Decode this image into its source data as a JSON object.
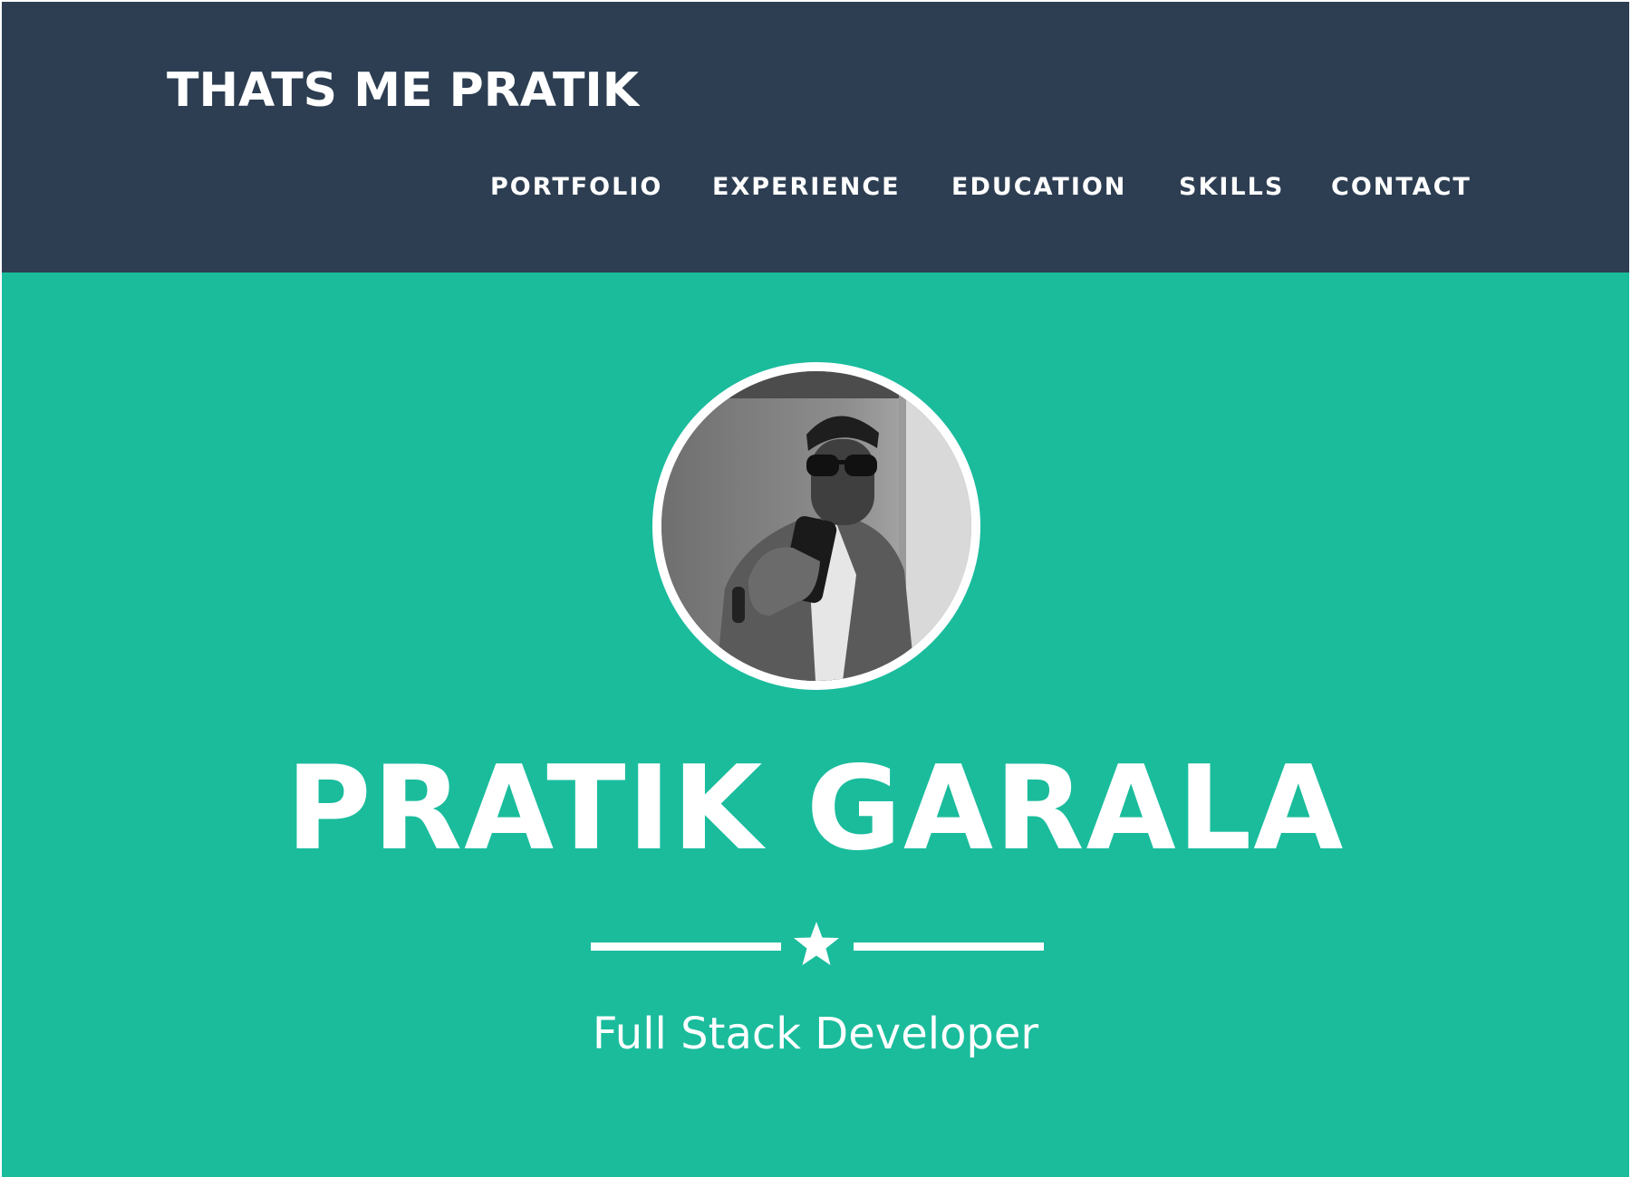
{
  "navbar": {
    "brand": "THATS ME PRATIK",
    "background": "#2d3e52",
    "links": [
      {
        "label": "PORTFOLIO"
      },
      {
        "label": "EXPERIENCE"
      },
      {
        "label": "EDUCATION"
      },
      {
        "label": "SKILLS"
      },
      {
        "label": "CONTACT"
      }
    ]
  },
  "hero": {
    "background": "#1abc9c",
    "name": "PRATIK GARALA",
    "subtitle": "Full Stack Developer",
    "divider_icon": "star-icon",
    "avatar_icon": "profile-photo"
  }
}
